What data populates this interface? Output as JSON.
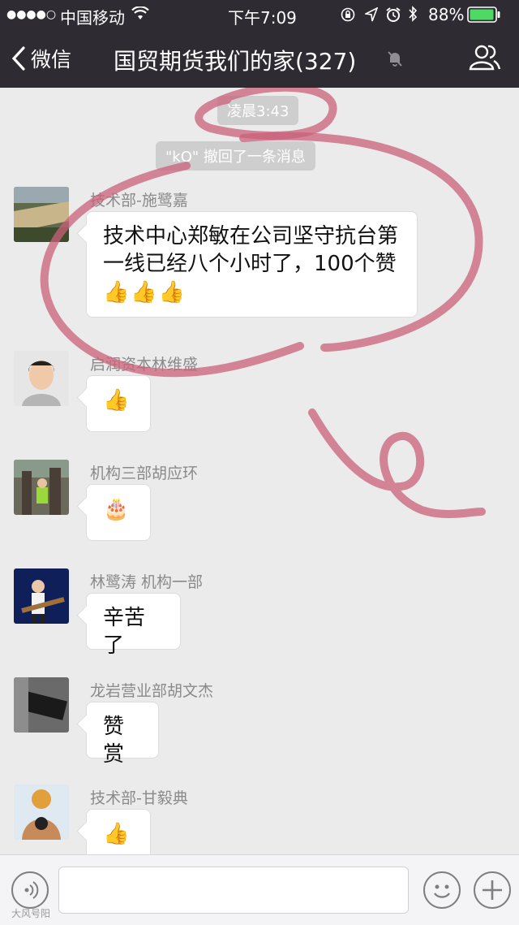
{
  "status_bar": {
    "signal": "●●●●○",
    "carrier": "中国移动",
    "time": "下午7:09",
    "battery": "88%"
  },
  "nav": {
    "back_label": "微信",
    "title": "国贸期货我们的家(327)"
  },
  "system": {
    "timestamp": "凌晨3:43",
    "recall_notice": "\"kO\" 撤回了一条消息"
  },
  "messages": [
    {
      "sender": "技术部-施鹭嘉",
      "text": "技术中心郑敏在公司坚守抗台第一线已经八个小时了，100个赞",
      "emoji": [
        "👍",
        "👍",
        "👍"
      ]
    },
    {
      "sender": "启润资本林维盛",
      "text": "",
      "emoji": [
        "👍"
      ]
    },
    {
      "sender": "机构三部胡应环",
      "text": "",
      "emoji": [
        "🎂"
      ]
    },
    {
      "sender": "林鹭涛 机构一部",
      "text": "辛苦了",
      "emoji": []
    },
    {
      "sender": "龙岩营业部胡文杰",
      "text": "赞赏",
      "emoji": []
    },
    {
      "sender": "技术部-甘毅典",
      "text": "",
      "emoji": [
        "👍"
      ]
    }
  ],
  "input": {
    "placeholder": ""
  },
  "watermark": "大风号阳"
}
